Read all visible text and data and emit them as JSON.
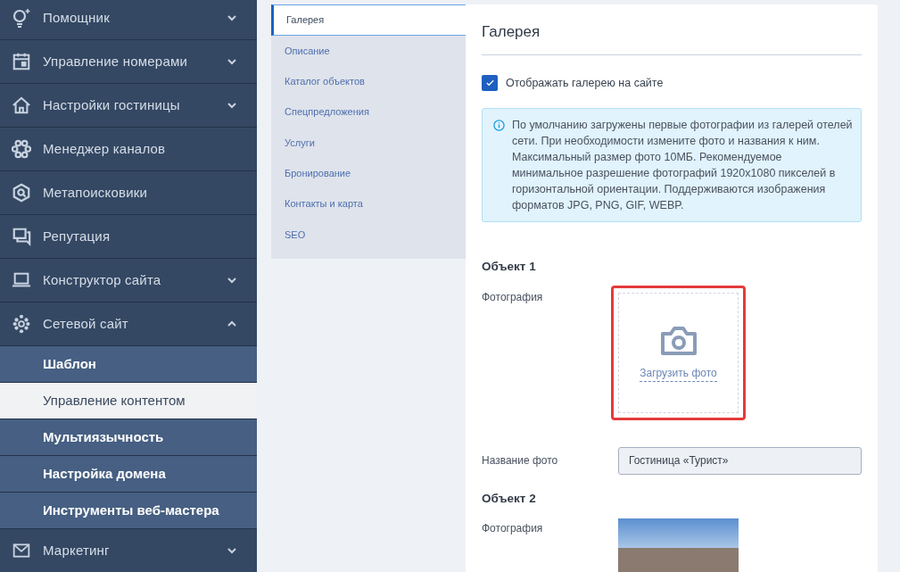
{
  "sidebar": {
    "items": [
      {
        "label": "Помощник",
        "expanded": false
      },
      {
        "label": "Управление номерами",
        "expanded": false
      },
      {
        "label": "Настройки гостиницы",
        "expanded": false
      },
      {
        "label": "Менеджер каналов"
      },
      {
        "label": "Метапоисковики"
      },
      {
        "label": "Репутация"
      },
      {
        "label": "Конструктор сайта",
        "expanded": false
      },
      {
        "label": "Сетевой сайт",
        "expanded": true,
        "children": [
          {
            "label": "Шаблон",
            "selected": false
          },
          {
            "label": "Управление контентом",
            "selected": true
          },
          {
            "label": "Мультиязычность",
            "selected": false
          },
          {
            "label": "Настройка домена",
            "selected": false
          },
          {
            "label": "Инструменты веб-мастера",
            "selected": false
          }
        ]
      },
      {
        "label": "Маркетинг",
        "expanded": false
      }
    ]
  },
  "tabs": [
    {
      "label": "Галерея",
      "selected": true
    },
    {
      "label": "Описание",
      "selected": false
    },
    {
      "label": "Каталог объектов",
      "selected": false
    },
    {
      "label": "Спецпредложения",
      "selected": false
    },
    {
      "label": "Услуги",
      "selected": false
    },
    {
      "label": "Бронирование",
      "selected": false
    },
    {
      "label": "Контакты и карта",
      "selected": false
    },
    {
      "label": "SEO",
      "selected": false
    }
  ],
  "panel": {
    "title": "Галерея",
    "show_gallery": {
      "label": "Отображать галерею на сайте",
      "checked": true
    },
    "info": "По умолчанию загружены первые фотографии из галерей отелей сети. При необходимости измените фото и названия к ним. Максимальный размер фото 10МБ. Рекомендуемое минимальное разрешение фотографий 1920x1080 пикселей в горизонтальной ориентации. Поддерживаются изображения форматов JPG, PNG, GIF, WEBP.",
    "objects": [
      {
        "title": "Объект 1",
        "photo_label": "Фотография",
        "photo": {
          "kind": "upload",
          "link": "Загрузить фото",
          "highlighted": true
        },
        "name_label": "Название фото",
        "name_value": "Гостиница «Турист»"
      },
      {
        "title": "Объект 2",
        "photo_label": "Фотография",
        "photo": {
          "kind": "image"
        }
      }
    ]
  }
}
